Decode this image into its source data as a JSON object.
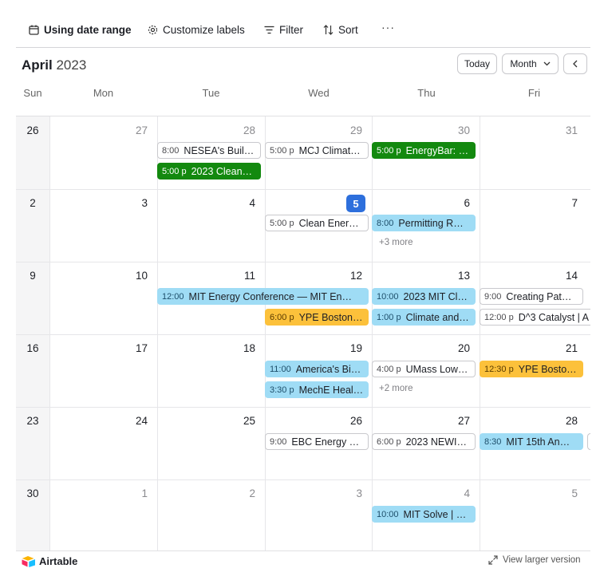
{
  "toolbar": {
    "date_range": "Using date range",
    "customize": "Customize labels",
    "filter": "Filter",
    "sort": "Sort",
    "more": "···"
  },
  "header": {
    "month": "April",
    "year": "2023",
    "today": "Today",
    "view": "Month"
  },
  "weekdays": [
    "Sun",
    "Mon",
    "Tue",
    "Wed",
    "Thu",
    "Fri"
  ],
  "weeks": [
    [
      "26",
      "27",
      "28",
      "29",
      "30",
      "31"
    ],
    [
      "2",
      "3",
      "4",
      "5",
      "6",
      "7"
    ],
    [
      "9",
      "10",
      "11",
      "12",
      "13",
      "14"
    ],
    [
      "16",
      "17",
      "18",
      "19",
      "20",
      "21"
    ],
    [
      "23",
      "24",
      "25",
      "26",
      "27",
      "28"
    ],
    [
      "30",
      "1",
      "2",
      "3",
      "4",
      "5"
    ]
  ],
  "events": {
    "e1": {
      "time": "8:00",
      "name": "NESEA's Buil…"
    },
    "e2": {
      "time": "5:00 p",
      "name": "2023 Clean…"
    },
    "e3": {
      "time": "5:00 p",
      "name": "MCJ Climat…"
    },
    "e4": {
      "time": "5:00 p",
      "name": "EnergyBar: …"
    },
    "e5": {
      "time": "5:00 p",
      "name": "Clean Ener…"
    },
    "e6": {
      "time": "8:00",
      "name": "Permitting R…"
    },
    "e7": {
      "time": "12:00",
      "name": "MIT Energy Conference — MIT En…"
    },
    "e8": {
      "time": "6:00 p",
      "name": "YPE Boston…"
    },
    "e9": {
      "time": "10:00",
      "name": "2023 MIT Cl…"
    },
    "e10": {
      "time": "1:00 p",
      "name": "Climate and…"
    },
    "e11": {
      "time": "9:00",
      "name": "Creating Pat…"
    },
    "e12": {
      "time": "12:00 p",
      "name": "D^3 Catalyst | A"
    },
    "e13": {
      "time": "11:00",
      "name": "America's Bi…"
    },
    "e14": {
      "time": "3:30 p",
      "name": "MechE Heal…"
    },
    "e15": {
      "time": "4:00 p",
      "name": "UMass Low…"
    },
    "e16": {
      "time": "12:30 p",
      "name": "YPE Bosto…"
    },
    "e17": {
      "time": "9:00",
      "name": "EBC Energy …"
    },
    "e18": {
      "time": "6:00 p",
      "name": "2023 NEWI…"
    },
    "e19": {
      "time": "8:30",
      "name": "MIT 15th An…"
    },
    "e20": {
      "time": "10:00",
      "name": "MIT Solve | …"
    }
  },
  "more": {
    "apr6": "+3 more",
    "apr20": "+2 more"
  },
  "footer": {
    "brand": "Airtable",
    "link": "View larger version"
  },
  "colors": {
    "green": "#13890f",
    "blue": "#9fdcf5",
    "yellow": "#fcc13b",
    "today": "#2d6fdc"
  }
}
